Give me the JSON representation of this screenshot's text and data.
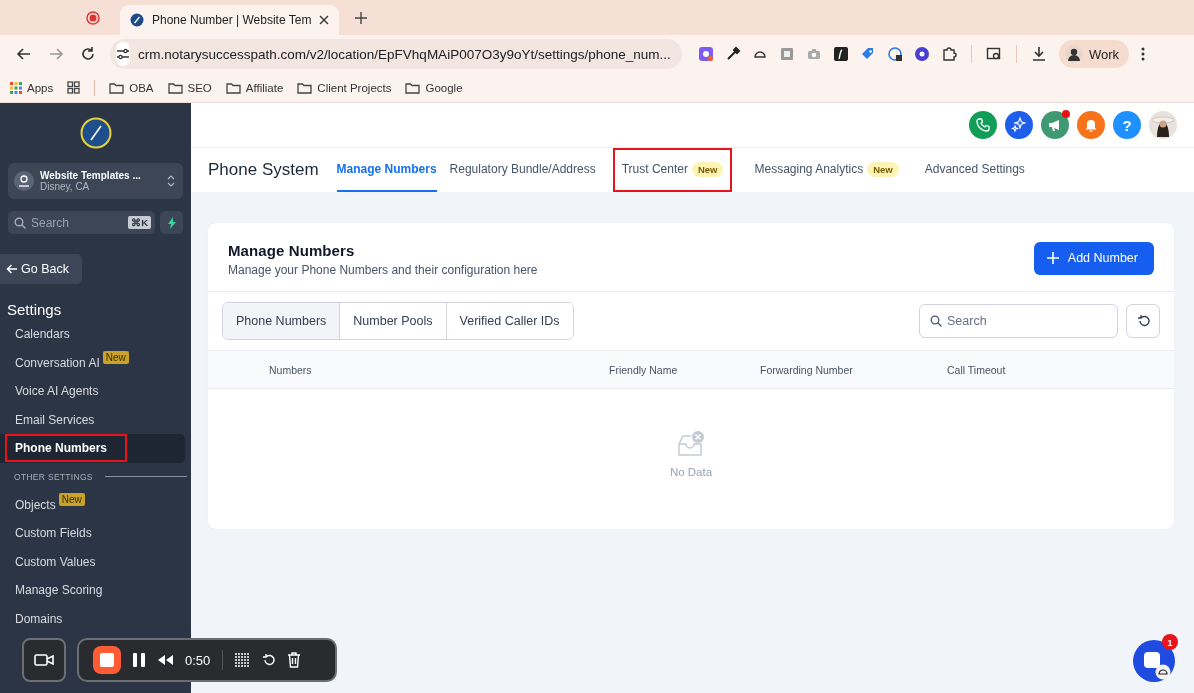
{
  "browser": {
    "tab": {
      "title": "Phone Number | Website Tem",
      "selected": true
    },
    "address": {
      "url": "crm.notarysuccesspath.com/v2/location/EpFVhqMAiP007O3y9oYt/settings/phone_num..."
    },
    "profile": {
      "label": "Work"
    },
    "bookmarks": [
      {
        "kind": "apps",
        "label": "Apps"
      },
      {
        "kind": "grid"
      },
      {
        "kind": "folder",
        "label": "OBA"
      },
      {
        "kind": "folder",
        "label": "SEO"
      },
      {
        "kind": "folder",
        "label": "Affiliate"
      },
      {
        "kind": "folder",
        "label": "Client Projects"
      },
      {
        "kind": "folder",
        "label": "Google"
      }
    ]
  },
  "sidebar": {
    "account": {
      "name": "Website Templates ...",
      "location": "Disney, CA"
    },
    "search": {
      "placeholder": "Search",
      "shortcut": "⌘K"
    },
    "back": "Go Back",
    "heading": "Settings",
    "items": [
      {
        "kind": "link",
        "label": "Calendars",
        "selected": false,
        "annotated": false
      },
      {
        "kind": "link",
        "label": "Conversation AI",
        "badge": "New",
        "selected": false,
        "annotated": false
      },
      {
        "kind": "link",
        "label": "Voice AI Agents",
        "selected": false,
        "annotated": false
      },
      {
        "kind": "link",
        "label": "Email Services",
        "selected": false,
        "annotated": false
      },
      {
        "kind": "link",
        "label": "Phone Numbers",
        "selected": true,
        "annotated": true
      },
      {
        "kind": "section",
        "label": "OTHER SETTINGS"
      },
      {
        "kind": "link",
        "label": "Objects",
        "badge": "New",
        "selected": false,
        "annotated": false
      },
      {
        "kind": "link",
        "label": "Custom Fields",
        "selected": false,
        "annotated": false
      },
      {
        "kind": "link",
        "label": "Custom Values",
        "selected": false,
        "annotated": false
      },
      {
        "kind": "link",
        "label": "Manage Scoring",
        "selected": false,
        "annotated": false
      },
      {
        "kind": "link",
        "label": "Domains",
        "selected": false,
        "annotated": false
      }
    ]
  },
  "header": {
    "help": "?",
    "announcement_dot": true
  },
  "page": {
    "title": "Phone System",
    "tabs": [
      {
        "label": "Manage Numbers",
        "selected": true,
        "annotated": false
      },
      {
        "label": "Regulatory Bundle/Address",
        "selected": false,
        "annotated": false
      },
      {
        "label": "Trust Center",
        "badge": "New",
        "selected": false,
        "annotated": true
      },
      {
        "label": "Messaging Analytics",
        "badge": "New",
        "selected": false,
        "annotated": false
      },
      {
        "label": "Advanced Settings",
        "selected": false,
        "annotated": false
      }
    ]
  },
  "card": {
    "title": "Manage Numbers",
    "subtitle": "Manage your Phone Numbers and their configuration here",
    "add_button": "Add Number",
    "views": [
      {
        "label": "Phone Numbers",
        "selected": true
      },
      {
        "label": "Number Pools",
        "selected": false
      },
      {
        "label": "Verified Caller IDs",
        "selected": false
      }
    ],
    "search": {
      "placeholder": "Search"
    },
    "table": {
      "columns": [
        "Numbers",
        "Friendly Name",
        "Forwarding Number",
        "Call Timeout"
      ],
      "empty": "No Data"
    }
  },
  "recorder": {
    "time": "0:50"
  },
  "chat": {
    "badge": "1"
  }
}
